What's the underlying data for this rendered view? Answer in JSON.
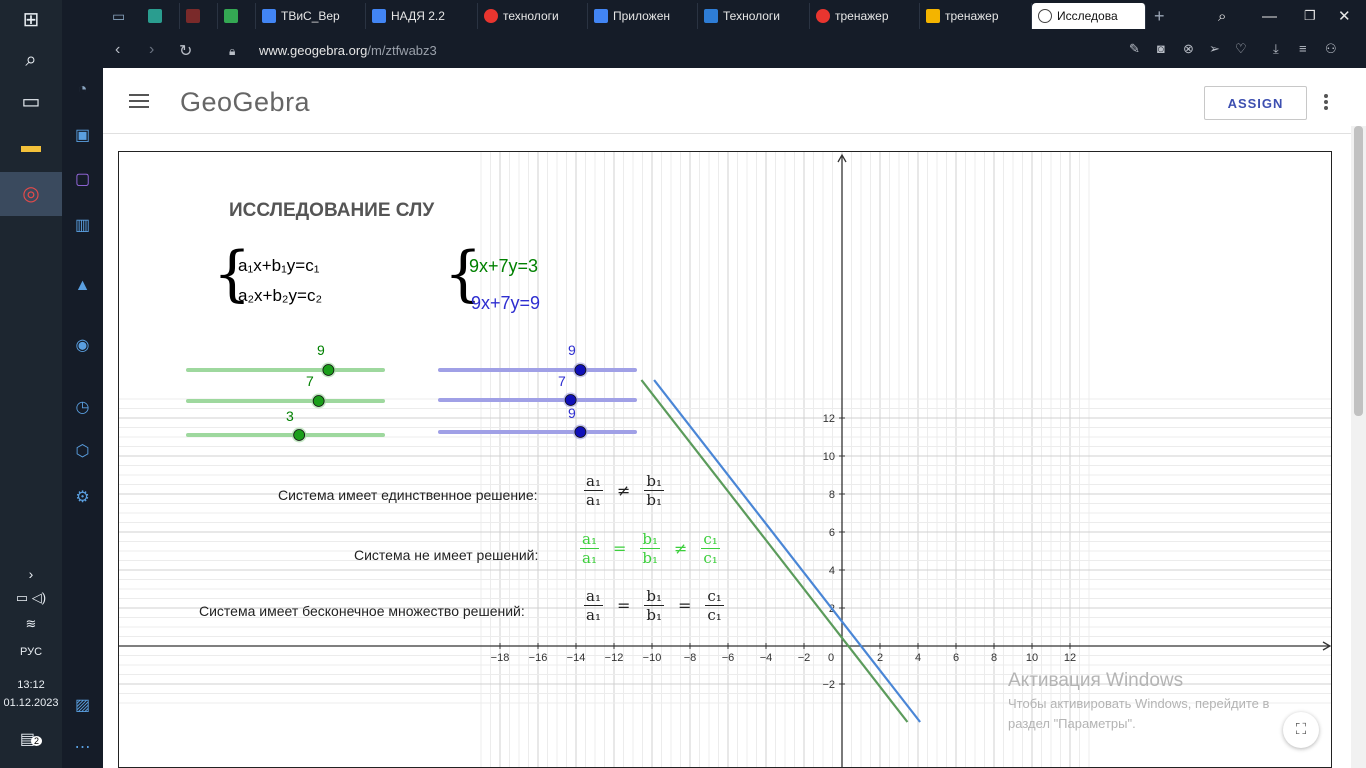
{
  "taskbar": {
    "language": "РУС",
    "time": "13:12",
    "date": "01.12.2023",
    "notification_count": "2"
  },
  "tabs": [
    {
      "label": "ТВиС_Вер",
      "color": "#4285f4"
    },
    {
      "label": "НАДЯ 2.2",
      "color": "#4285f4"
    },
    {
      "label": "технологи",
      "color": "#e8352f"
    },
    {
      "label": "Приложен",
      "color": "#4285f4"
    },
    {
      "label": "Технологи",
      "color": "#2e7dd6"
    },
    {
      "label": "тренажер",
      "color": "#e8352f"
    },
    {
      "label": "тренажер",
      "color": "#f4b400"
    },
    {
      "label": "Исследова",
      "color": "#444444"
    }
  ],
  "address": {
    "domain": "www.geogebra.org",
    "path": "/m/ztfwabz3"
  },
  "header": {
    "logo": "GeoGebra",
    "assign_label": "ASSIGN"
  },
  "applet": {
    "title": "ИССЛЕДОВАНИЕ СЛУ",
    "general_eq1": "a₁x+b₁y=c₁",
    "general_eq2": "a₂x+b₂y=c₂",
    "eq1": "9x+7y=3",
    "eq2": "9x+7y=9",
    "eq1_color": "#008000",
    "eq2_color": "#2e2ed0",
    "sliders_green": [
      {
        "name": "a1",
        "value": "9",
        "fraction": 0.72
      },
      {
        "name": "b1",
        "value": "7",
        "fraction": 0.67
      },
      {
        "name": "c1",
        "value": "3",
        "fraction": 0.57
      }
    ],
    "sliders_blue": [
      {
        "name": "a2",
        "value": "9",
        "fraction": 0.72
      },
      {
        "name": "b2",
        "value": "7",
        "fraction": 0.67
      },
      {
        "name": "c2",
        "value": "9",
        "fraction": 0.72
      }
    ],
    "cond_unique": "Система имеет единственное решение:",
    "cond_none": "Система не имеет решений:",
    "cond_infinite": "Система имеет бесконечное множество решений:",
    "frac": {
      "a1": "a₁",
      "b1": "b₁",
      "c1": "c₁",
      "neq": "≠",
      "eq": "="
    }
  },
  "watermark": {
    "title": "Активация Windows",
    "line1": "Чтобы активировать Windows, перейдите в",
    "line2": "раздел \"Параметры\"."
  },
  "chart_data": {
    "type": "line",
    "xlim": [
      -19,
      13
    ],
    "ylim": [
      -3,
      13
    ],
    "x_ticks": [
      -18,
      -16,
      -14,
      -12,
      -10,
      -8,
      -6,
      -4,
      -2,
      0,
      2,
      4,
      6,
      8,
      10,
      12
    ],
    "y_ticks": [
      -2,
      2,
      4,
      6,
      8,
      10,
      12
    ],
    "grid": true,
    "series": [
      {
        "name": "9x+7y=3",
        "a": 9,
        "b": 7,
        "c": 3,
        "color": "#5b9b5b"
      },
      {
        "name": "9x+7y=9",
        "a": 9,
        "b": 7,
        "c": 9,
        "color": "#4a86d6"
      }
    ]
  }
}
